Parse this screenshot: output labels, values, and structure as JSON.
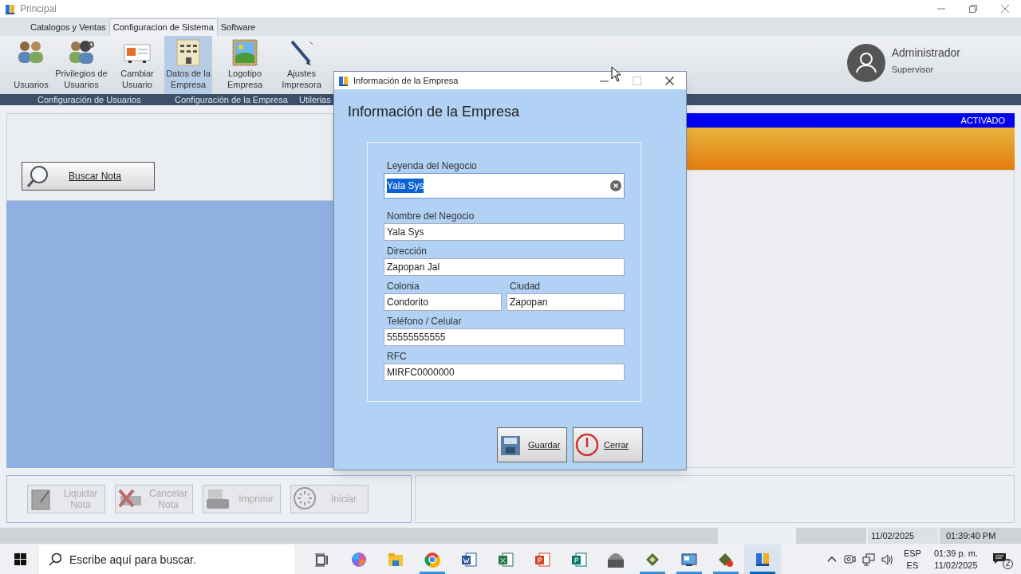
{
  "window": {
    "title": "Principal"
  },
  "tabs": [
    {
      "label": "Catalogos y Ventas",
      "selected": false
    },
    {
      "label": "Configuracion de Sistema",
      "selected": true
    },
    {
      "label": "Software",
      "selected": false
    }
  ],
  "ribbon": {
    "buttons": [
      {
        "kind": "users",
        "label": "Usuarios",
        "selected": false
      },
      {
        "kind": "privileges",
        "label": "Privilegios de Usuarios",
        "selected": false
      },
      {
        "kind": "card",
        "label": "Cambiar Usuario",
        "selected": false
      },
      {
        "kind": "building",
        "label": "Datos de la Empresa",
        "selected": true
      },
      {
        "kind": "image",
        "label": "Logotipo Empresa",
        "selected": false
      },
      {
        "kind": "pen",
        "label": "Ajustes Impresora",
        "selected": false
      }
    ],
    "groups": [
      "Configuración de Usuarios",
      "Configuración de la Empresa",
      "Utilerias"
    ]
  },
  "user": {
    "name": "Administrador",
    "role": "Supervisor"
  },
  "license_bar": {
    "status": "ACTIVADO"
  },
  "search_button": {
    "label": "Buscar Nota"
  },
  "action_buttons": [
    {
      "kind": "pad",
      "label": "Liquidar Nota",
      "disabled": true
    },
    {
      "kind": "cancel",
      "label": "Cancelar Nota",
      "disabled": true
    },
    {
      "kind": "printer",
      "label": "Imprimir",
      "disabled": true
    },
    {
      "kind": "spinner",
      "label": "Iniciar",
      "disabled": true
    }
  ],
  "status_bar": {
    "date": "11/02/2025",
    "time": "01:39:40 PM"
  },
  "dialog": {
    "title": "Información de la Empresa",
    "heading": "Información de la Empresa",
    "rows": [
      [
        {
          "label": "Leyenda del Negocio",
          "value": "Yala Sys",
          "focused": true
        }
      ],
      [
        {
          "label": "Nombre del Negocio",
          "value": "Yala Sys",
          "focused": false
        }
      ],
      [
        {
          "label": "Dirección",
          "value": "Zapopan Jal",
          "focused": false
        }
      ],
      [
        {
          "label": "Colonia",
          "value": "Condorito",
          "focused": false
        },
        {
          "label": "Ciudad",
          "value": "Zapopan",
          "focused": false
        }
      ],
      [
        {
          "label": "Teléfono / Celular",
          "value": "55555555555",
          "focused": false
        }
      ],
      [
        {
          "label": "RFC",
          "value": "MIRFC0000000",
          "focused": false
        }
      ]
    ],
    "buttons": [
      {
        "kind": "save",
        "label": "Guardar"
      },
      {
        "kind": "close",
        "label": "Cerrar"
      }
    ]
  },
  "taskbar": {
    "search_placeholder": "Escribe aquí para buscar.",
    "apps": [
      {
        "kind": "task-view",
        "running": false,
        "selected": false
      },
      {
        "kind": "copilot",
        "running": false,
        "selected": false
      },
      {
        "kind": "folder",
        "running": false,
        "selected": false
      },
      {
        "kind": "chrome",
        "running": true,
        "selected": false
      },
      {
        "kind": "word",
        "running": false,
        "selected": false
      },
      {
        "kind": "excel",
        "running": false,
        "selected": false
      },
      {
        "kind": "powerpoint",
        "running": false,
        "selected": false
      },
      {
        "kind": "publisher",
        "running": false,
        "selected": false
      },
      {
        "kind": "scanner",
        "running": false,
        "selected": false
      },
      {
        "kind": "disk",
        "running": true,
        "selected": false
      },
      {
        "kind": "monitor",
        "running": true,
        "selected": false
      },
      {
        "kind": "disk-stop",
        "running": true,
        "selected": false
      },
      {
        "kind": "books",
        "running": true,
        "selected": true
      }
    ],
    "language": "ESP",
    "layout": "ES",
    "clock_time": "01:39 p. m.",
    "clock_date": "11/02/2025",
    "notifications": "2"
  }
}
